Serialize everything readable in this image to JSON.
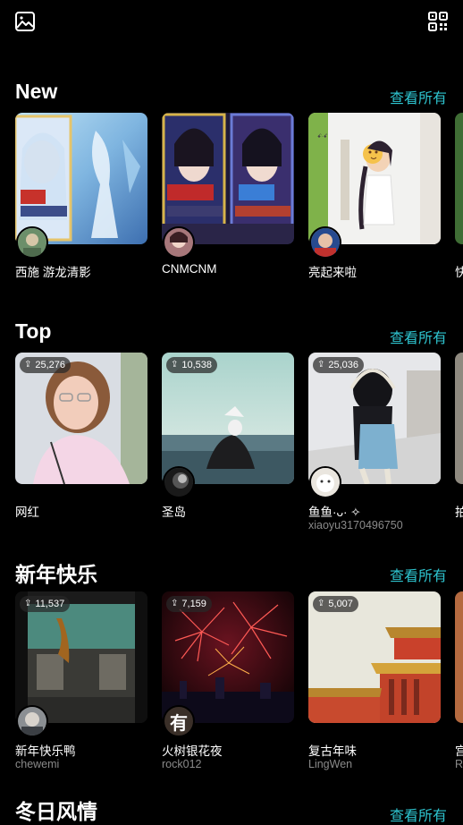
{
  "topbar": {
    "left_icon": "image-icon",
    "right_icon": "qr-code-icon"
  },
  "colors": {
    "accent": "#2ec4cf",
    "background": "#000000",
    "muted": "#8a8a8a"
  },
  "sections": [
    {
      "title": "New",
      "see_all": "查看所有",
      "cards": [
        {
          "name": "西施 游龙清影"
        },
        {
          "name": "CNMCNM"
        },
        {
          "name": "亮起来啦"
        },
        {
          "name": "快"
        }
      ]
    },
    {
      "title": "Top",
      "see_all": "查看所有",
      "cards": [
        {
          "count": "25,276",
          "name": "网红"
        },
        {
          "count": "10,538",
          "name": "圣岛"
        },
        {
          "count": "25,036",
          "name": "鱼鱼·ᴗ· ✧",
          "user": "xiaoyu3170496750"
        },
        {
          "name": "拍"
        }
      ]
    },
    {
      "title": "新年快乐",
      "see_all": "查看所有",
      "cards": [
        {
          "count": "11,537",
          "name": "新年快乐鸭",
          "user": "chewemi"
        },
        {
          "count": "7,159",
          "name": "火树银花夜",
          "user": "rock012",
          "avatar_text": "有"
        },
        {
          "count": "5,007",
          "name": "复古年味",
          "user": "LingWen"
        },
        {
          "name": "宫",
          "user": "R"
        }
      ]
    },
    {
      "title": "冬日风情",
      "see_all": "查看所有"
    }
  ]
}
